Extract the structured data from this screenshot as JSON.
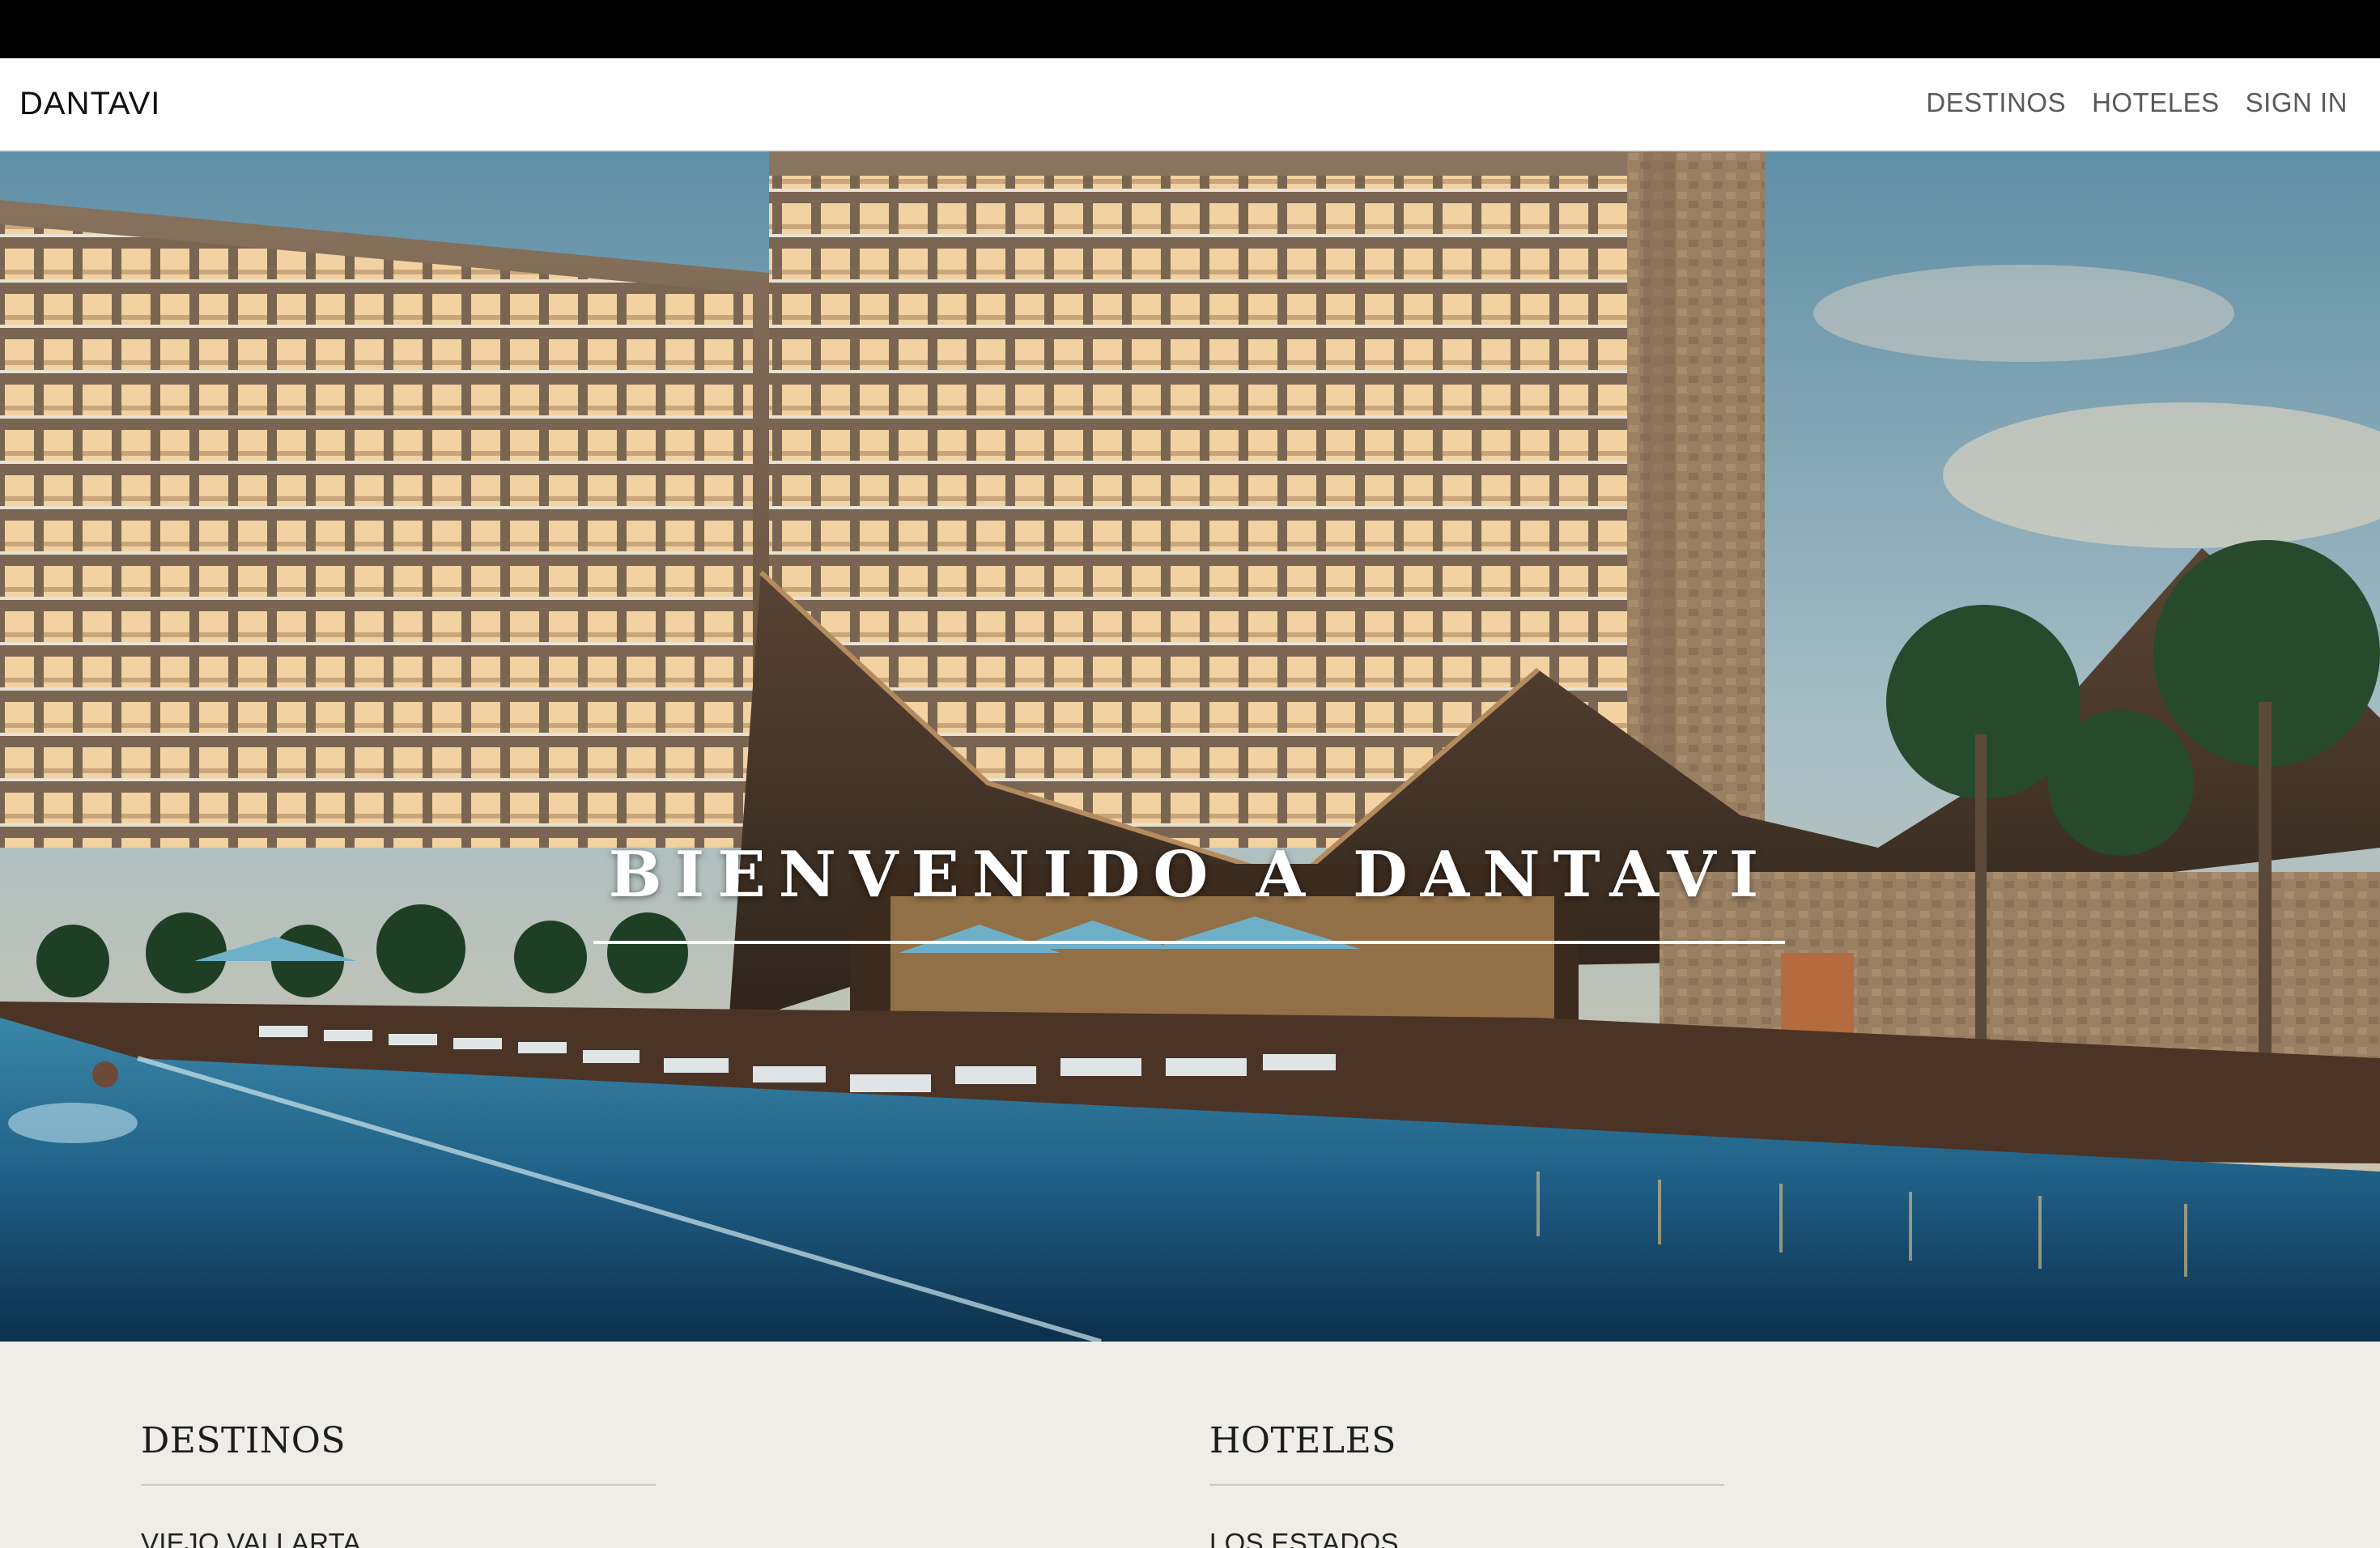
{
  "brand": "DANTAVI",
  "nav": {
    "destinos": "DESTINOS",
    "hoteles": "HOTELES",
    "signin": "SIGN IN"
  },
  "hero": {
    "title": "BIENVENIDO A DANTAVI"
  },
  "footer": {
    "destinos": {
      "heading": "DESTINOS",
      "items": [
        "VIEJO VALLARTA"
      ]
    },
    "hoteles": {
      "heading": "HOTELES",
      "items": [
        "LOS ESTADOS"
      ]
    }
  },
  "colors": {
    "topbar": "#000000",
    "navbar": "#ffffff",
    "footer_bg": "#efede8",
    "pool": "#1f5f86"
  }
}
